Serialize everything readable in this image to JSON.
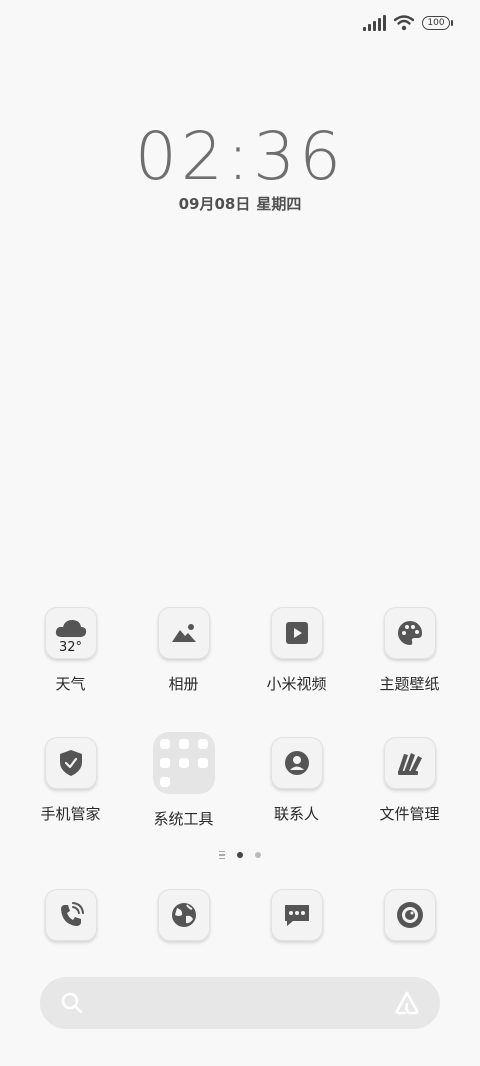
{
  "status_bar": {
    "battery": "100",
    "icons": [
      "signal-icon",
      "wifi-icon",
      "battery-icon"
    ]
  },
  "clock": {
    "time": "02:36",
    "date": "09月08日",
    "weekday": "星期四"
  },
  "apps_row1": [
    {
      "label": "天气",
      "icon": "weather-cloud-icon",
      "badge": "32°"
    },
    {
      "label": "相册",
      "icon": "gallery-icon"
    },
    {
      "label": "小米视频",
      "icon": "video-play-icon"
    },
    {
      "label": "主题壁纸",
      "icon": "palette-icon"
    }
  ],
  "apps_row2": [
    {
      "label": "手机管家",
      "icon": "security-shield-icon"
    },
    {
      "label": "系统工具",
      "icon": "folder-icon"
    },
    {
      "label": "联系人",
      "icon": "contacts-icon"
    },
    {
      "label": "文件管理",
      "icon": "file-manager-icon"
    }
  ],
  "dock": [
    {
      "icon": "phone-icon"
    },
    {
      "icon": "browser-icon"
    },
    {
      "icon": "messages-icon"
    },
    {
      "icon": "camera-icon"
    }
  ],
  "page_indicator": {
    "pages": 2,
    "active": 1
  },
  "search_bar": {
    "icons": [
      "search-icon",
      "assistant-icon"
    ]
  }
}
